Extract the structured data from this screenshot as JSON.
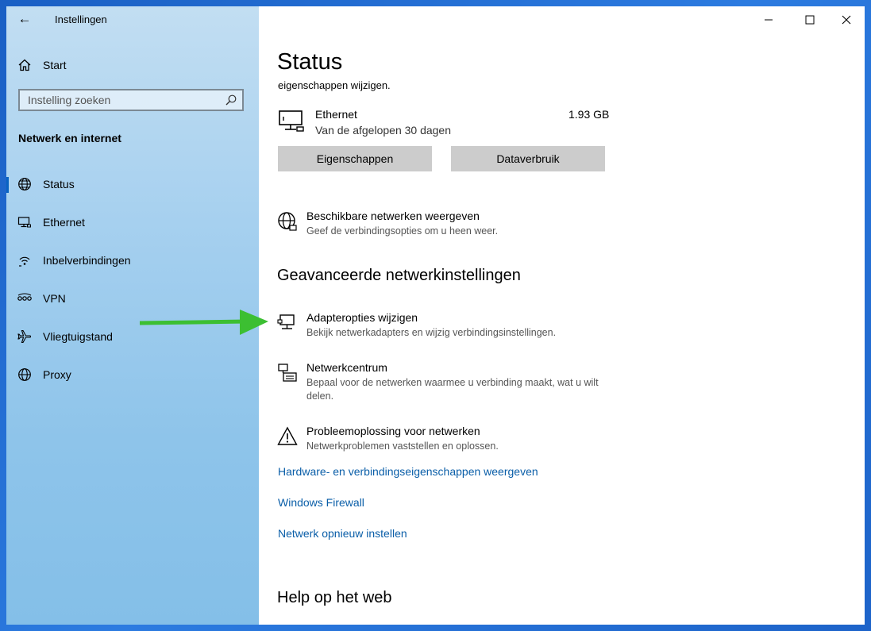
{
  "window": {
    "app_title": "Instellingen"
  },
  "sidebar": {
    "home_label": "Start",
    "search_placeholder": "Instelling zoeken",
    "section_title": "Netwerk en internet",
    "items": [
      {
        "label": "Status",
        "icon": "globe-icon",
        "selected": true
      },
      {
        "label": "Ethernet",
        "icon": "monitor-icon",
        "selected": false
      },
      {
        "label": "Inbelverbindingen",
        "icon": "dialup-icon",
        "selected": false
      },
      {
        "label": "VPN",
        "icon": "vpn-icon",
        "selected": false
      },
      {
        "label": "Vliegtuigstand",
        "icon": "airplane-icon",
        "selected": false
      },
      {
        "label": "Proxy",
        "icon": "globe-icon",
        "selected": false
      }
    ]
  },
  "main": {
    "title": "Status",
    "subtitle": "eigenschappen wijzigen.",
    "ethernet": {
      "name": "Ethernet",
      "usage": "1.93 GB",
      "period": "Van de afgelopen 30 dagen",
      "properties_button": "Eigenschappen",
      "data_usage_button": "Dataverbruik"
    },
    "available_networks": {
      "title": "Beschikbare netwerken weergeven",
      "description": "Geef de verbindingsopties om u heen weer."
    },
    "advanced_heading": "Geavanceerde netwerkinstellingen",
    "advanced_items": [
      {
        "title": "Adapteropties wijzigen",
        "description": "Bekijk netwerkadapters en wijzig verbindingsinstellingen."
      },
      {
        "title": "Netwerkcentrum",
        "description": "Bepaal voor de netwerken waarmee u verbinding maakt, wat u wilt delen."
      },
      {
        "title": "Probleemoplossing voor netwerken",
        "description": "Netwerkproblemen vaststellen en oplossen."
      }
    ],
    "links": [
      "Hardware- en verbindingseigenschappen weergeven",
      "Windows Firewall",
      "Netwerk opnieuw instellen"
    ],
    "help_heading": "Help op het web"
  },
  "colors": {
    "accent": "#0a63c2",
    "link": "#0a5ea8",
    "annotation_arrow": "#3cbf32",
    "button_bg": "#cccccc"
  }
}
